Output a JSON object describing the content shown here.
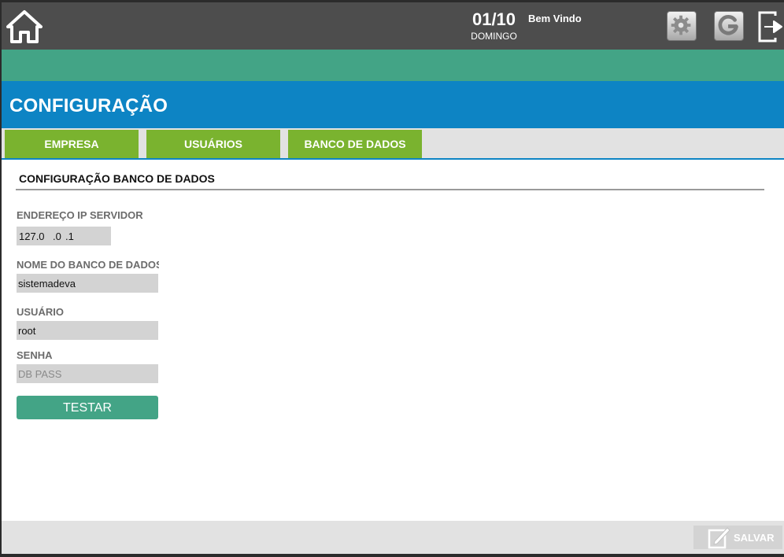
{
  "header": {
    "date": "01/10",
    "day": "DOMINGO",
    "welcome": "Bem Vindo",
    "icons": [
      "home-icon",
      "gear-icon",
      "power-icon",
      "exit-icon"
    ]
  },
  "page": {
    "title": "CONFIGURAÇÃO"
  },
  "tabs": [
    {
      "label": "EMPRESA"
    },
    {
      "label": "USUÁRIOS"
    },
    {
      "label": "BANCO DE DADOS"
    }
  ],
  "section": {
    "title": "CONFIGURAÇÃO BANCO DE DADOS"
  },
  "form": {
    "ip_label": "ENDEREÇO IP SERVIDOR",
    "ip_segments": [
      "127.0",
      ".0",
      ".1"
    ],
    "dbname_label": "NOME DO BANCO DE DADOS",
    "dbname_value": "sistemadeva",
    "user_label": "USUÁRIO",
    "user_value": "root",
    "password_label": "SENHA",
    "password_placeholder": "DB PASS",
    "test_button": "TESTAR"
  },
  "footer": {
    "save_label": "SALVAR"
  },
  "colors": {
    "topbar": "#4d4d4d",
    "green_band": "#43a486",
    "title_bar": "#0d84c4",
    "tab": "#7ab32f",
    "input_bg": "#d3d3d3"
  }
}
